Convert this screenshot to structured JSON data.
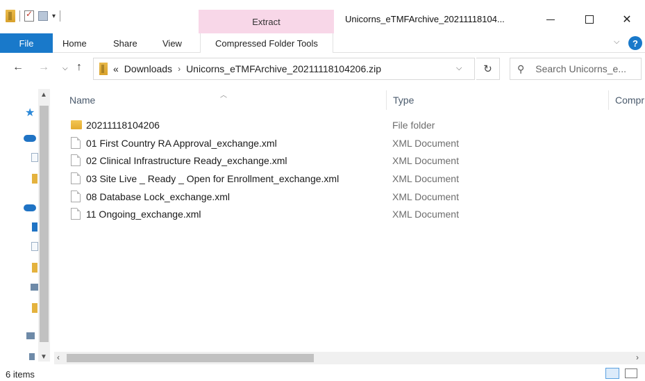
{
  "window": {
    "title": "Unicorns_eTMFArchive_20211118104...",
    "contextual_group": "Extract",
    "contextual_group_color": "#f8d7e8"
  },
  "ribbon": {
    "tabs": [
      "File",
      "Home",
      "Share",
      "View",
      "Compressed Folder Tools"
    ],
    "file_tab_color": "#1979ca"
  },
  "address": {
    "overflow": "«",
    "crumbs": [
      "Downloads",
      "Unicorns_eTMFArchive_20211118104206.zip"
    ],
    "separator": "›"
  },
  "search": {
    "placeholder": "Search Unicorns_e..."
  },
  "columns": {
    "name": "Name",
    "type": "Type",
    "compressed": "Compr"
  },
  "files": [
    {
      "name": "20211118104206",
      "type": "File folder",
      "icon": "folder-icon"
    },
    {
      "name": "01 First Country RA Approval_exchange.xml",
      "type": "XML Document",
      "icon": "xml-file-icon"
    },
    {
      "name": "02 Clinical Infrastructure Ready_exchange.xml",
      "type": "XML Document",
      "icon": "xml-file-icon"
    },
    {
      "name": "03 Site Live _ Ready _ Open for Enrollment_exchange.xml",
      "type": "XML Document",
      "icon": "xml-file-icon"
    },
    {
      "name": "08 Database Lock_exchange.xml",
      "type": "XML Document",
      "icon": "xml-file-icon"
    },
    {
      "name": "11 Ongoing_exchange.xml",
      "type": "XML Document",
      "icon": "xml-file-icon"
    }
  ],
  "status": {
    "item_count": "6 items"
  },
  "icons": {
    "back": "←",
    "forward": "→",
    "up": "↑",
    "refresh": "↻",
    "search": "⚲",
    "help": "?"
  }
}
